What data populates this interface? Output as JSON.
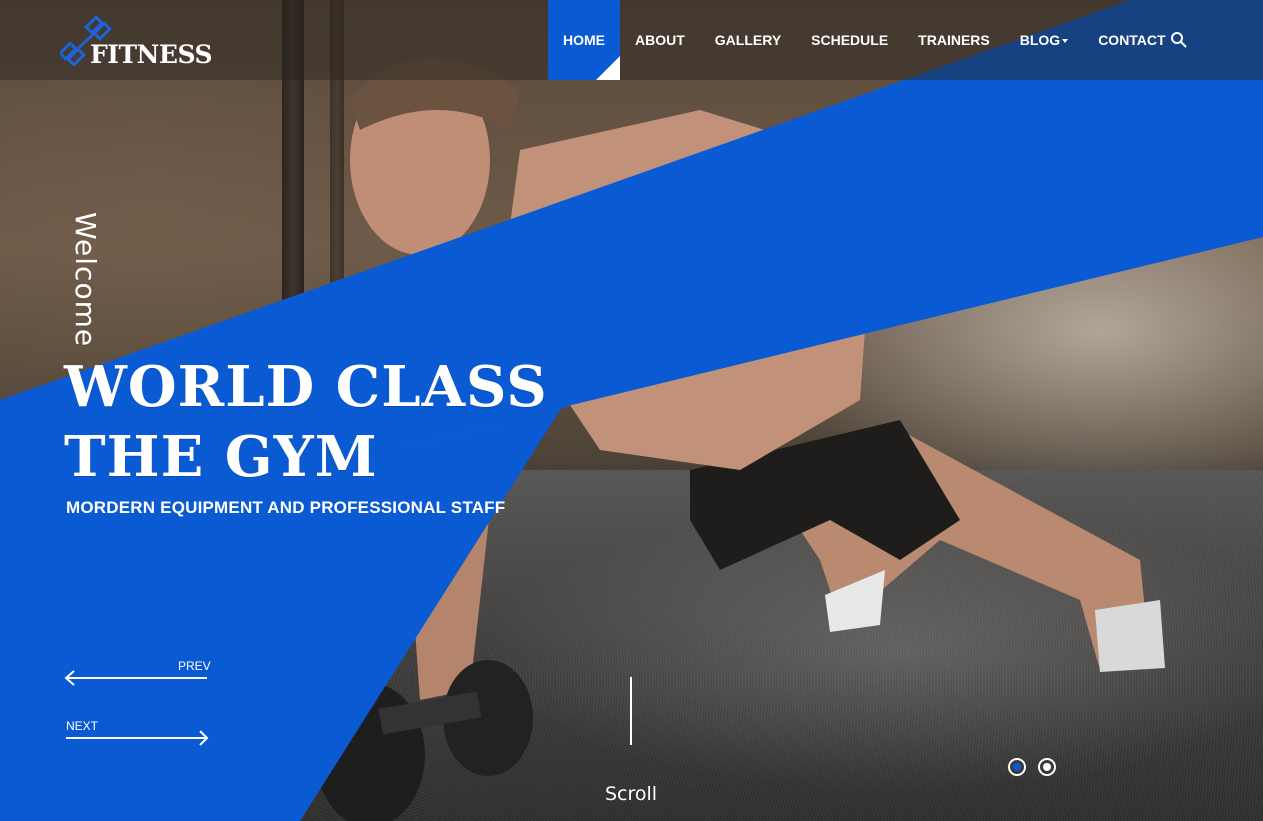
{
  "brand": {
    "name": "FITNESS",
    "logo_icon": "dumbbell-icon",
    "accent_color": "#0a5bd3"
  },
  "nav": {
    "items": [
      {
        "label": "HOME",
        "active": true
      },
      {
        "label": "ABOUT"
      },
      {
        "label": "GALLERY"
      },
      {
        "label": "SCHEDULE"
      },
      {
        "label": "TRAINERS"
      },
      {
        "label": "BLOG",
        "has_dropdown": true
      },
      {
        "label": "CONTACT"
      }
    ],
    "search_icon": "search-icon"
  },
  "hero": {
    "welcome": "Welcome",
    "headline_line1": "WORLD CLASS",
    "headline_line2": "THE GYM",
    "subheadline": "MORDERN EQUIPMENT AND PROFESSIONAL STAFF"
  },
  "slider": {
    "prev_label": "PREV",
    "next_label": "NEXT",
    "scroll_label": "Scroll",
    "dots": [
      {
        "active": true
      },
      {
        "active": false
      }
    ]
  }
}
